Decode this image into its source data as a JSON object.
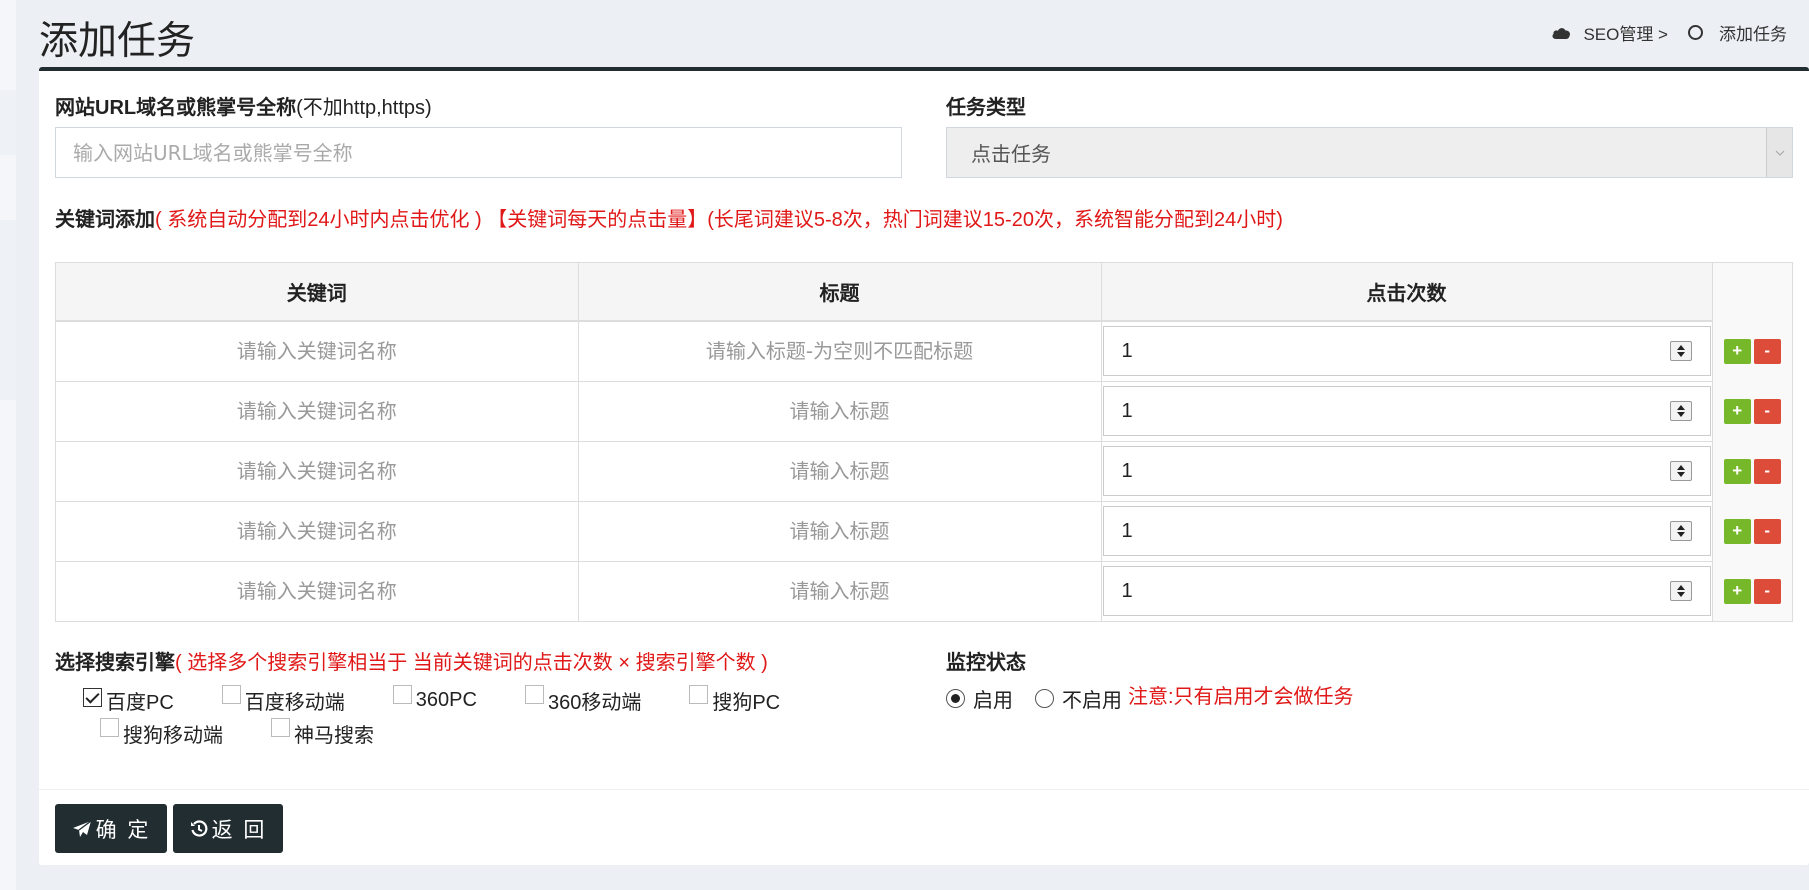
{
  "page": {
    "title": "添加任务"
  },
  "breadcrumb": {
    "parent": "SEO管理 >",
    "current": "添加任务"
  },
  "form": {
    "url": {
      "label_bold": "网站URL域名或熊掌号全称",
      "label_suffix": "(不加http,https)",
      "placeholder": "输入网站URL域名或熊掌号全称",
      "value": ""
    },
    "task_type": {
      "label": "任务类型",
      "selected": "点击任务"
    },
    "keywords": {
      "label_bold": "关键词添加",
      "note": "( 系统自动分配到24小时内点击优化 ) 【关键词每天的点击量】(长尾词建议5-8次，热门词建议15-20次，系统智能分配到24小时)",
      "columns": [
        "关键词",
        "标题",
        "点击次数"
      ],
      "rows": [
        {
          "keyword_placeholder": "请输入关键词名称",
          "title_placeholder": "请输入标题-为空则不匹配标题",
          "clicks": "1"
        },
        {
          "keyword_placeholder": "请输入关键词名称",
          "title_placeholder": "请输入标题",
          "clicks": "1"
        },
        {
          "keyword_placeholder": "请输入关键词名称",
          "title_placeholder": "请输入标题",
          "clicks": "1"
        },
        {
          "keyword_placeholder": "请输入关键词名称",
          "title_placeholder": "请输入标题",
          "clicks": "1"
        },
        {
          "keyword_placeholder": "请输入关键词名称",
          "title_placeholder": "请输入标题",
          "clicks": "1"
        }
      ],
      "add_symbol": "+",
      "remove_symbol": "-"
    },
    "search_engines": {
      "label_bold": "选择搜索引擎",
      "note": "( 选择多个搜索引擎相当于 当前关键词的点击次数 × 搜索引擎个数 )",
      "options": [
        {
          "label": "百度PC",
          "checked": true
        },
        {
          "label": "百度移动端",
          "checked": false
        },
        {
          "label": "360PC",
          "checked": false
        },
        {
          "label": "360移动端",
          "checked": false
        },
        {
          "label": "搜狗PC",
          "checked": false
        },
        {
          "label": "搜狗移动端",
          "checked": false
        },
        {
          "label": "神马搜索",
          "checked": false
        }
      ]
    },
    "monitor": {
      "label": "监控状态",
      "options": [
        {
          "label": "启用",
          "selected": true
        },
        {
          "label": "不启用",
          "selected": false
        }
      ],
      "note": "注意:只有启用才会做任务"
    }
  },
  "actions": {
    "confirm_label": "确 定",
    "back_label": "返 回"
  },
  "colors": {
    "dark_button": "#222d32",
    "plus_button": "#76b82a",
    "minus_button": "#dd4b39",
    "note_red": "#e01818"
  }
}
